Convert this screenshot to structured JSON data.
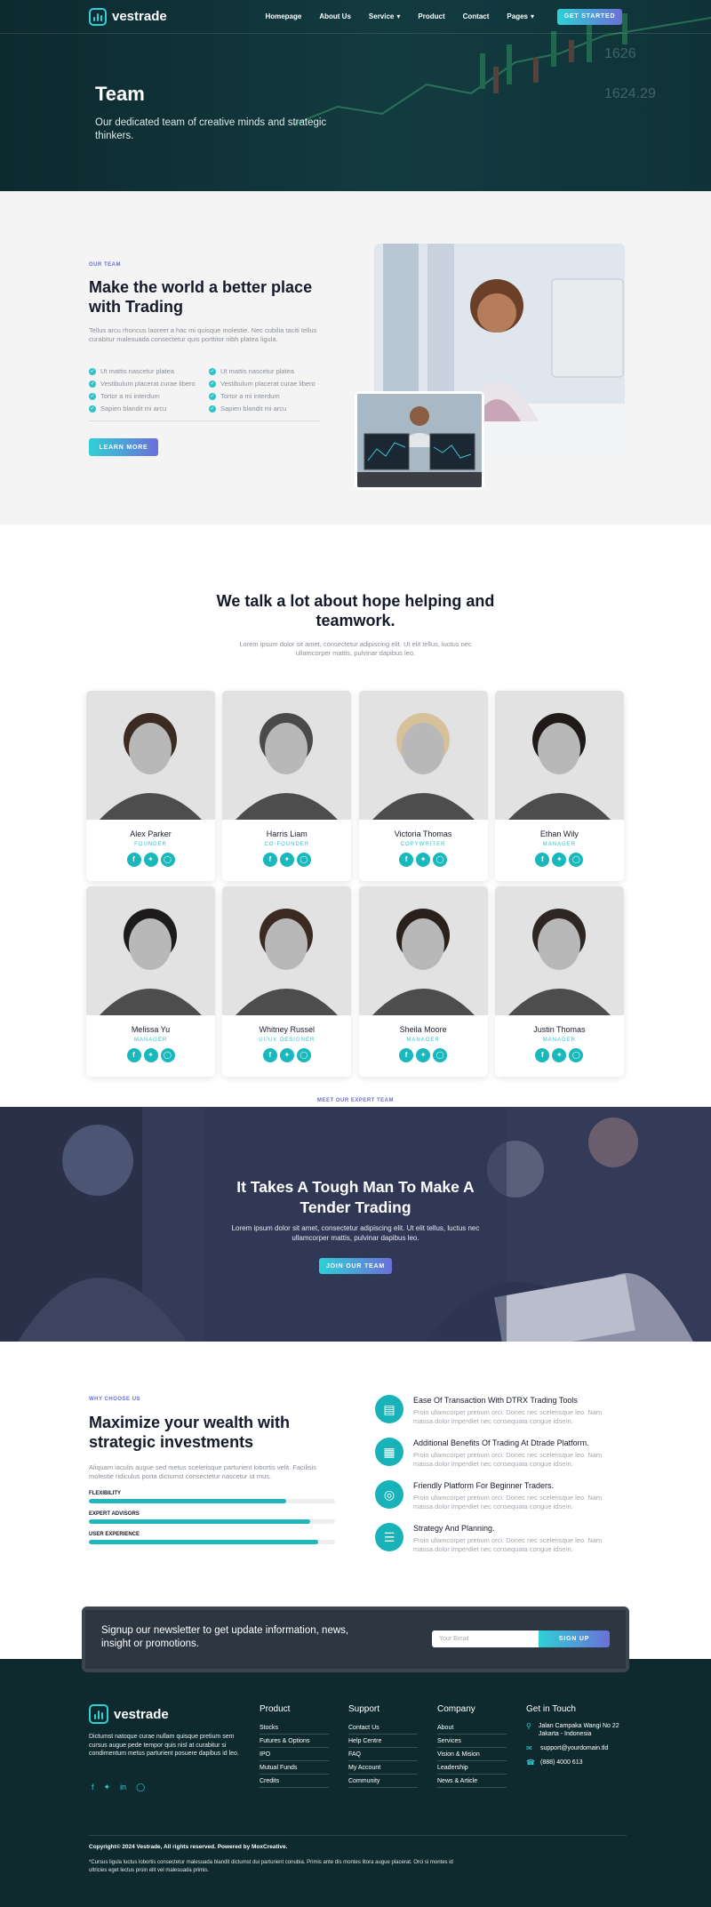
{
  "brand": {
    "name": "vestrade",
    "accent": "#2fd0d6",
    "accent2": "#6b6fd8",
    "dark": "#0f2a2e"
  },
  "nav": {
    "items": [
      "Homepage",
      "About Us",
      "Service",
      "Product",
      "Contact",
      "Pages"
    ],
    "cta": "GET STARTED"
  },
  "hero": {
    "title": "Team",
    "subtitle": "Our dedicated team of creative minds and strategic thinkers."
  },
  "about": {
    "eyebrow": "OUR TEAM",
    "title": "Make the world a better place with Trading",
    "desc": "Tellus arcu rhoncus laoreet a hac mi quisque molestie. Nec cubilia taciti tellus curabitur malesuada consectetur quis porttitor nibh platea ligula.",
    "checks": [
      "Ut mattis nascetur platea",
      "Ut mattis nascetur platea",
      "Vestibulum placerat curae libero",
      "Vestibulum placerat curae libero",
      "Tortor a mi interdum",
      "Tortor a mi interdum",
      "Sapien blandit mi arcu",
      "Sapien blandit mi arcu"
    ],
    "button": "LEARN MORE"
  },
  "team": {
    "eyebrow": "MEET OUR EXPERT TEAM",
    "title": "We talk a lot about hope helping and teamwork.",
    "desc": "Lorem ipsum dolor sit amet, consectetur adipiscing elit. Ut elit tellus, luctus nec ullamcorper mattis, pulvinar dapibus leo.",
    "members": [
      {
        "name": "Alex Parker",
        "role": "FOUNDER"
      },
      {
        "name": "Harris Liam",
        "role": "CO-FOUNDER"
      },
      {
        "name": "Victoria Thomas",
        "role": "COPYWRITER"
      },
      {
        "name": "Ethan Wily",
        "role": "MANAGER"
      },
      {
        "name": "Melissa Yu",
        "role": "MANAGER"
      },
      {
        "name": "Whitney Russel",
        "role": "UI/UX DESIGNER"
      },
      {
        "name": "Sheila Moore",
        "role": "MANAGER"
      },
      {
        "name": "Justin Thomas",
        "role": "MANAGER"
      }
    ]
  },
  "banner": {
    "title": "It Takes A Tough Man To Make A Tender Trading",
    "desc": "Lorem ipsum dolor sit amet, consectetur adipiscing elit. Ut elit tellus, luctus nec ullamcorper mattis, pulvinar dapibus leo.",
    "button": "JOIN OUR TEAM"
  },
  "why": {
    "eyebrow": "WHY CHOOSE US",
    "title": "Maximize your wealth with strategic investments",
    "desc": "Aliquam iaculis augue sed metus scelerisque parturient lobortis velit. Facilisis molestie ridiculus porta dictumst consectetur nascetur ut mus.",
    "skills": [
      {
        "label": "FLEXIBILITY",
        "value": 0.8
      },
      {
        "label": "EXPERT ADVISORS",
        "value": 0.9
      },
      {
        "label": "USER EXPERIENCE",
        "value": 0.93
      }
    ],
    "features": [
      {
        "title": "Ease Of Transaction With DTRX Trading Tools",
        "desc": "Proin ullamcorper pretium orci. Donec nec scelerisque leo. Nam massa dolor imperdiet nec consequata congue idsem."
      },
      {
        "title": "Additional Benefits Of Trading At Dtrade Platform.",
        "desc": "Proin ullamcorper pretium orci. Donec nec scelerisque leo. Nam massa dolor imperdiet nec consequata congue idsem."
      },
      {
        "title": "Friendly Platform For Beginner Traders.",
        "desc": "Proin ullamcorper pretium orci. Donec nec scelerisque leo. Nam massa dolor imperdiet nec consequata congue idsem."
      },
      {
        "title": "Strategy And Planning.",
        "desc": "Proin ullamcorper pretium orci. Donec nec scelerisque leo. Nam massa dolor imperdiet nec consequata congue idsem."
      }
    ]
  },
  "newsletter": {
    "text": "Signup our newsletter to get update information, news, insight or promotions.",
    "placeholder": "Your Email",
    "button": "SIGN UP"
  },
  "footer": {
    "desc": "Dictumst natoque curae nullam quisque pretium sem cursus augue pede tempor quis nisl at curabitur si condimentum metus parturient posuere dapibus id leo.",
    "columns": [
      {
        "title": "Product",
        "links": [
          "Stocks",
          "Futures & Options",
          "IPO",
          "Mutual Funds",
          "Credits"
        ]
      },
      {
        "title": "Support",
        "links": [
          "Contact Us",
          "Help Centre",
          "FAQ",
          "My Account",
          "Community"
        ]
      },
      {
        "title": "Company",
        "links": [
          "About",
          "Services",
          "Vision & Mision",
          "Leadership",
          "News & Article"
        ]
      }
    ],
    "contact": {
      "title": "Get in Touch",
      "address": "Jalan Campaka Wangi No 22 Jakarta - Indonesia",
      "email": "support@yourdomain.tld",
      "phone": "(888) 4000 613"
    },
    "copyright": "Copyright© 2024 Vestrade, All rights reserved. Powered by MoxCreative.",
    "fine": "*Cursus ligula luctus lobortis consectetur malesuada blandit dictumst dui parturient conubia. Primis ante dis montes litora augue placerat. Orci si montes id ultricies eget lectus proin elit vel malesuada primis."
  }
}
